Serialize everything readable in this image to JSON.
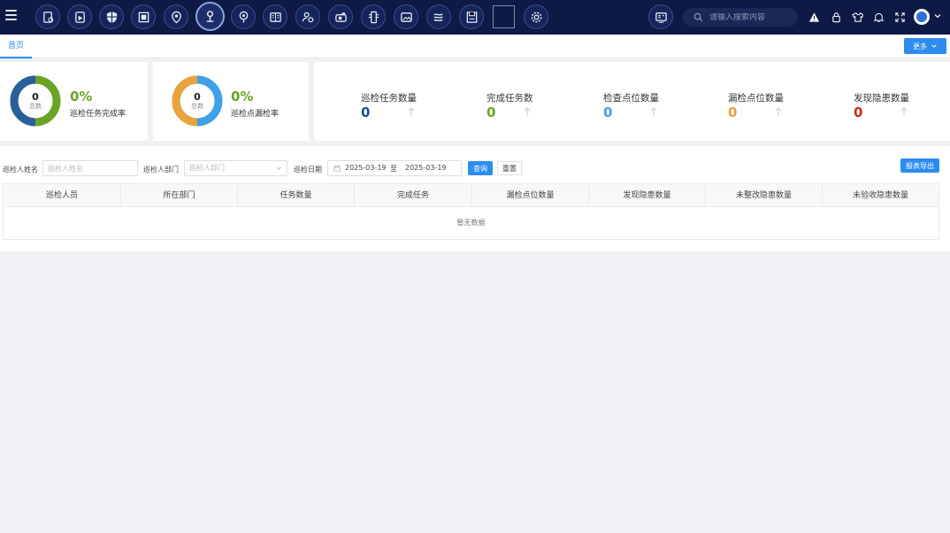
{
  "topbar": {
    "search_placeholder": "请输入搜索内容",
    "nav_icons": [
      "report-check-icon",
      "document-play-icon",
      "shield-grid-icon",
      "dashboard-box-icon",
      "location-pin-icon",
      "inspection-person-icon",
      "map-pin-circle-icon",
      "book-icon",
      "people-gear-icon",
      "camera-data-icon",
      "scanner-icon",
      "calendar-image-icon",
      "wind-icon",
      "save-disk-icon",
      "blank-square-icon",
      "settings-gear-icon"
    ],
    "active_nav": "inspection-person-icon",
    "tools": [
      "screen-monitor-icon",
      "warning-icon",
      "lock-icon",
      "shirt-icon",
      "bell-icon",
      "fullscreen-icon"
    ]
  },
  "tabs": {
    "home": "首页",
    "more": "更多"
  },
  "donuts": [
    {
      "value": "0",
      "center_label": "总数",
      "percent": "0%",
      "label": "巡检任务完成率",
      "color_a": "#2b5f9c",
      "color_b": "#6aa326"
    },
    {
      "value": "0",
      "center_label": "总数",
      "percent": "0%",
      "label": "巡检点漏检率",
      "color_a": "#e8a33d",
      "color_b": "#3fa0e8"
    }
  ],
  "metrics": [
    {
      "label": "巡检任务数量",
      "value": "0",
      "color": "#1f4e89"
    },
    {
      "label": "完成任务数",
      "value": "0",
      "color": "#6aa326"
    },
    {
      "label": "检查点位数量",
      "value": "0",
      "color": "#3fa0e8"
    },
    {
      "label": "漏检点位数量",
      "value": "0",
      "color": "#e8a33d"
    },
    {
      "label": "发现隐患数量",
      "value": "0",
      "color": "#d0261d"
    }
  ],
  "filters": {
    "name_label": "巡检人姓名",
    "name_placeholder": "巡检人姓名",
    "dept_label": "巡检人部门",
    "dept_placeholder": "巡检人部门",
    "date_label": "巡检日期",
    "date_start": "2025-03-19",
    "date_sep": "至",
    "date_end": "2025-03-19",
    "query": "查询",
    "reset": "重置",
    "export": "报表导出"
  },
  "table": {
    "columns": [
      "巡检人员",
      "所在部门",
      "任务数量",
      "完成任务",
      "漏检点位数量",
      "发现隐患数量",
      "未整改隐患数量",
      "未验收隐患数量"
    ],
    "empty_text": "暂无数据"
  }
}
